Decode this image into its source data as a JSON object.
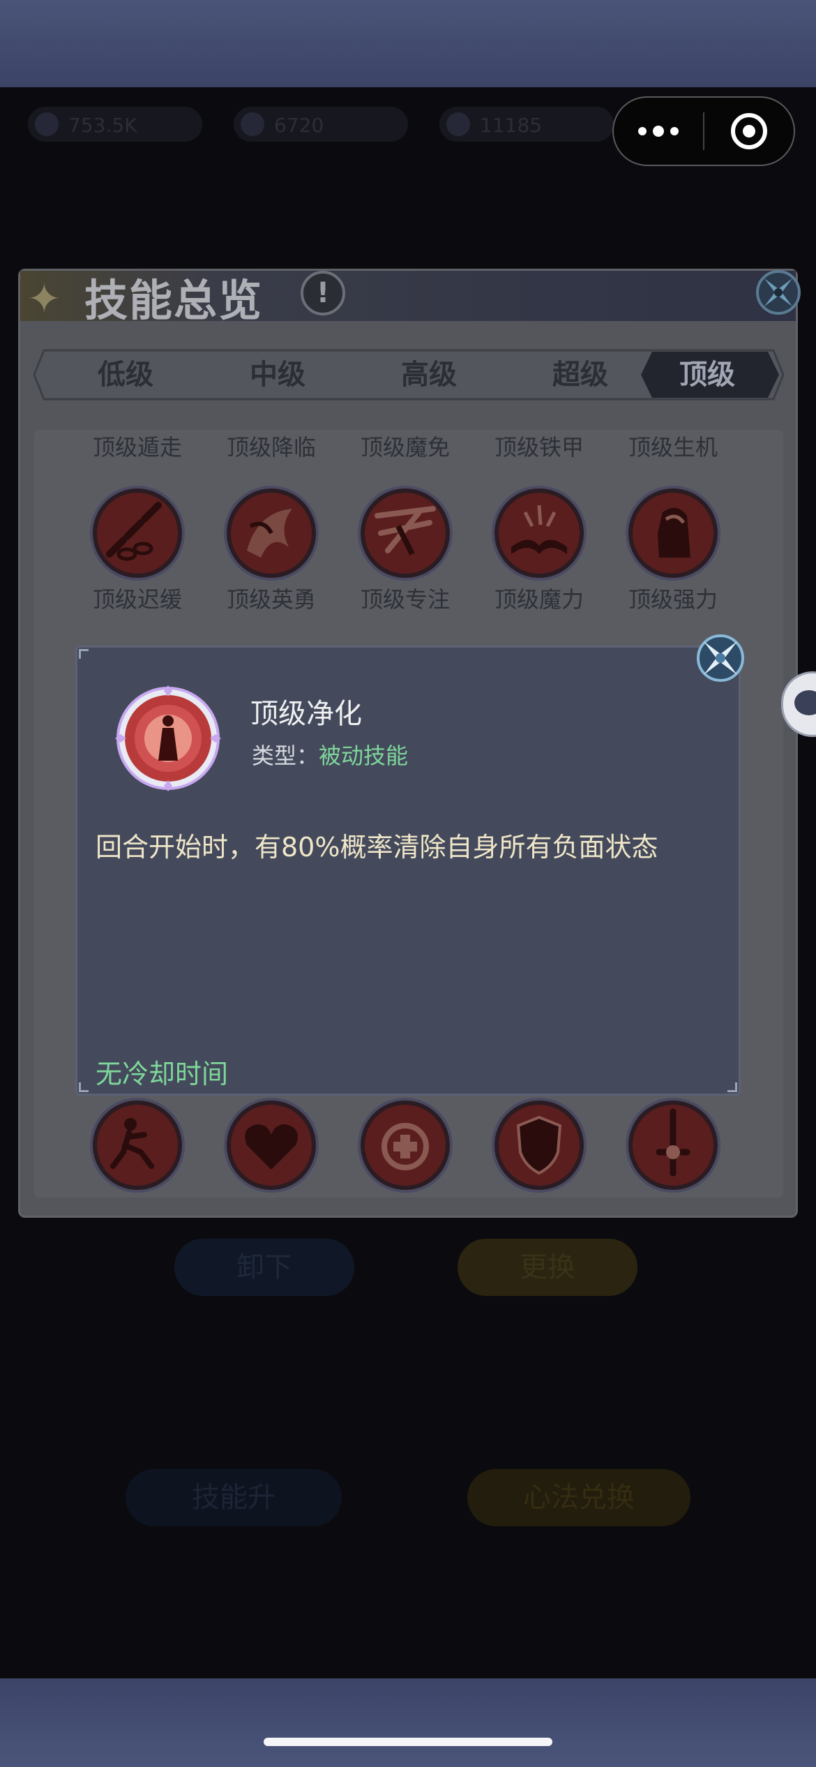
{
  "capsule": {
    "more_icon": "more-dots-icon",
    "close_icon": "target-circle-icon"
  },
  "background": {
    "resources": [
      "753.5K",
      "6720",
      "11185"
    ],
    "unequip_label": "卸下",
    "replace_label": "更换",
    "skill_upgrade_label": "技能升",
    "skill_exchange_label": "心法兑换"
  },
  "dialog": {
    "title": "技能总览",
    "info_icon": "exclamation-icon",
    "tabs": [
      "低级",
      "中级",
      "高级",
      "超级",
      "顶级"
    ],
    "active_tab": "顶级",
    "row1_labels": [
      "顶级遁走",
      "顶级降临",
      "顶级魔免",
      "顶级铁甲",
      "顶级生机"
    ],
    "row2_labels": [
      "顶级迟缓",
      "顶级英勇",
      "顶级专注",
      "顶级魔力",
      "顶级强力"
    ],
    "row1_icons": [
      "chains-skill-icon",
      "dragon-claw-skill-icon",
      "shield-break-skill-icon",
      "book-skill-icon",
      "hooded-figure-skill-icon"
    ],
    "bottom_icons": [
      "runner-skill-icon",
      "heart-skill-icon",
      "medical-cross-skill-icon",
      "armor-shield-skill-icon",
      "sword-skill-icon"
    ]
  },
  "detail": {
    "name": "顶级净化",
    "type_label": "类型：",
    "type_value": "被动技能",
    "description": "回合开始时，有80%概率清除自身所有负面状态",
    "cooldown": "无冷却时间",
    "icon": "purify-figure-icon"
  },
  "colors": {
    "accent_green": "#7ed69a",
    "desc_text": "#efe6c8",
    "skill_red": "#9b2a2a"
  }
}
